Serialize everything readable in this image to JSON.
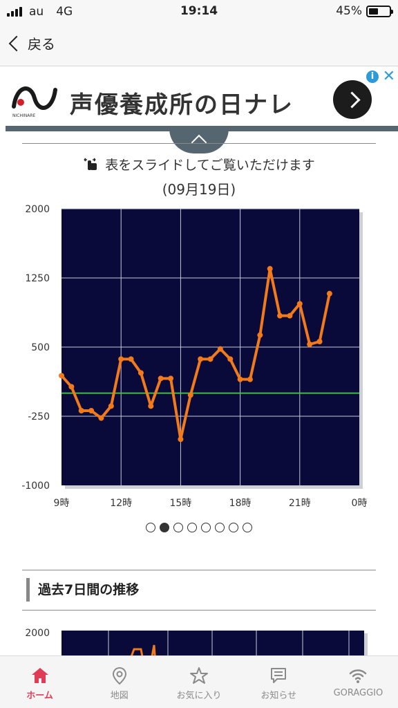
{
  "status_bar": {
    "carrier": "au",
    "network": "4G",
    "time": "19:14",
    "battery": "45%",
    "battery_level": 0.45
  },
  "nav": {
    "back_label": "戻る"
  },
  "ad": {
    "text": "声優養成所の日ナレ",
    "logo_text": "NICHINARE"
  },
  "slide_hint": "表をスライドしてご覧いただけます",
  "chart_date": "(09月19日)",
  "chart_data": {
    "type": "line",
    "xlabels": [
      "9時",
      "12時",
      "15時",
      "18時",
      "21時",
      "0時"
    ],
    "x_ticks": [
      9,
      12,
      15,
      18,
      21,
      24
    ],
    "ylabels": [
      "2000",
      "1250",
      "500",
      "-250",
      "-1000"
    ],
    "y_ticks": [
      2000,
      1250,
      500,
      -250,
      -1000
    ],
    "ylim": [
      -1000,
      2000
    ],
    "xlim": [
      9,
      24
    ],
    "baseline": 0,
    "grid": true,
    "colors": {
      "background": "#0a0a3a",
      "line": "#f07a1c",
      "baseline": "#3fbf3f",
      "grid": "#c8c8d8"
    },
    "x": [
      9.0,
      9.5,
      10.0,
      10.5,
      11.0,
      11.5,
      12.0,
      12.5,
      13.0,
      13.5,
      14.0,
      14.5,
      15.0,
      15.5,
      16.0,
      16.5,
      17.0,
      17.5,
      18.0,
      18.5,
      19.0,
      19.5,
      20.0,
      20.5,
      21.0,
      21.5,
      22.0,
      22.5
    ],
    "y": [
      190,
      70,
      -190,
      -190,
      -270,
      -140,
      370,
      370,
      220,
      -140,
      160,
      160,
      -500,
      -20,
      370,
      370,
      480,
      370,
      150,
      150,
      630,
      1350,
      840,
      840,
      970,
      530,
      560,
      1080
    ]
  },
  "section": {
    "title": "過去7日間の推移"
  },
  "chart2": {
    "ylabel_top": "2000"
  },
  "pager": {
    "count": 8,
    "active": 1
  },
  "tabs": [
    {
      "label": "ホーム",
      "icon": "home-icon",
      "active": true
    },
    {
      "label": "地図",
      "icon": "map-pin-icon",
      "active": false
    },
    {
      "label": "お気に入り",
      "icon": "star-icon",
      "active": false
    },
    {
      "label": "お知らせ",
      "icon": "message-icon",
      "active": false
    },
    {
      "label": "GORAGGIO",
      "icon": "wifi-icon",
      "active": false
    }
  ]
}
